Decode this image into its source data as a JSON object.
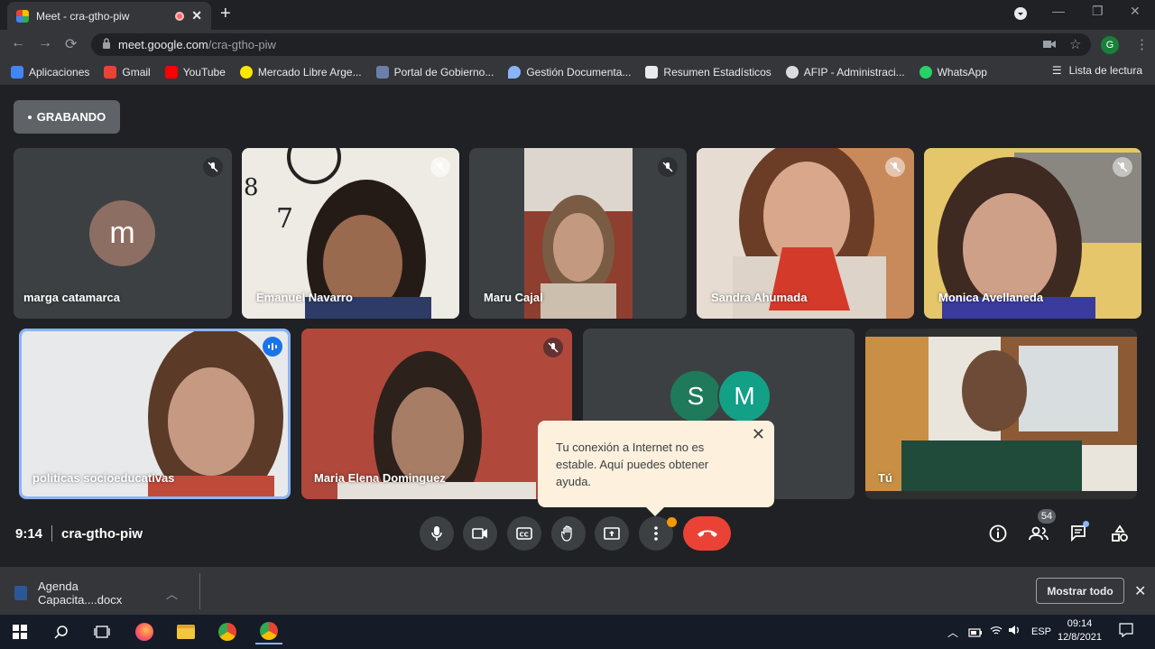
{
  "browser": {
    "tab_title": "Meet - cra-gtho-piw",
    "url_host": "meet.google.com",
    "url_path": "/cra-gtho-piw",
    "profile_initial": "G",
    "bookmarks": [
      {
        "label": "Aplicaciones",
        "color": "#4285f4"
      },
      {
        "label": "Gmail",
        "color": "#ea4335"
      },
      {
        "label": "YouTube",
        "color": "#ff0000"
      },
      {
        "label": "Mercado Libre Arge...",
        "color": "#ffe600"
      },
      {
        "label": "Portal de Gobierno...",
        "color": "#6b7fa8"
      },
      {
        "label": "Gestión Documenta...",
        "color": "#8ab4f8"
      },
      {
        "label": "Resumen Estadísticos",
        "color": "#e8eaed"
      },
      {
        "label": "AFIP - Administraci...",
        "color": "#dadce0"
      },
      {
        "label": "WhatsApp",
        "color": "#25d366"
      }
    ],
    "reading_list": "Lista de lectura"
  },
  "meet": {
    "recording_label": "GRABANDO",
    "participants_row1": [
      {
        "name": "marga catamarca",
        "avatar_letter": "m",
        "avatar_color": "#8d6e63",
        "muted": true
      },
      {
        "name": "Emanuel Navarro",
        "muted": true
      },
      {
        "name": "Maru Cajal",
        "muted": true
      },
      {
        "name": "Sandra Ahumada",
        "muted": true
      },
      {
        "name": "Monica Avellaneda",
        "muted": true
      }
    ],
    "participants_row2": [
      {
        "name": "politicas socioeducativas",
        "speaking": true
      },
      {
        "name": "Maria Elena Dominguez",
        "muted": true
      },
      {
        "name": "",
        "avatars": [
          {
            "letter": "S",
            "color": "#1e7a5a"
          },
          {
            "letter": "M",
            "color": "#12a087"
          }
        ]
      },
      {
        "name": "Tú"
      }
    ],
    "popup": {
      "text": "Tu conexión a Internet no es estable. Aquí puedes obtener ayuda."
    },
    "time": "9:14",
    "meeting_code": "cra-gtho-piw",
    "participant_count": "54"
  },
  "downloads": {
    "file_name": "Agenda Capacita....docx",
    "show_all": "Mostrar todo"
  },
  "taskbar": {
    "language": "ESP",
    "time": "09:14",
    "date": "12/8/2021"
  }
}
